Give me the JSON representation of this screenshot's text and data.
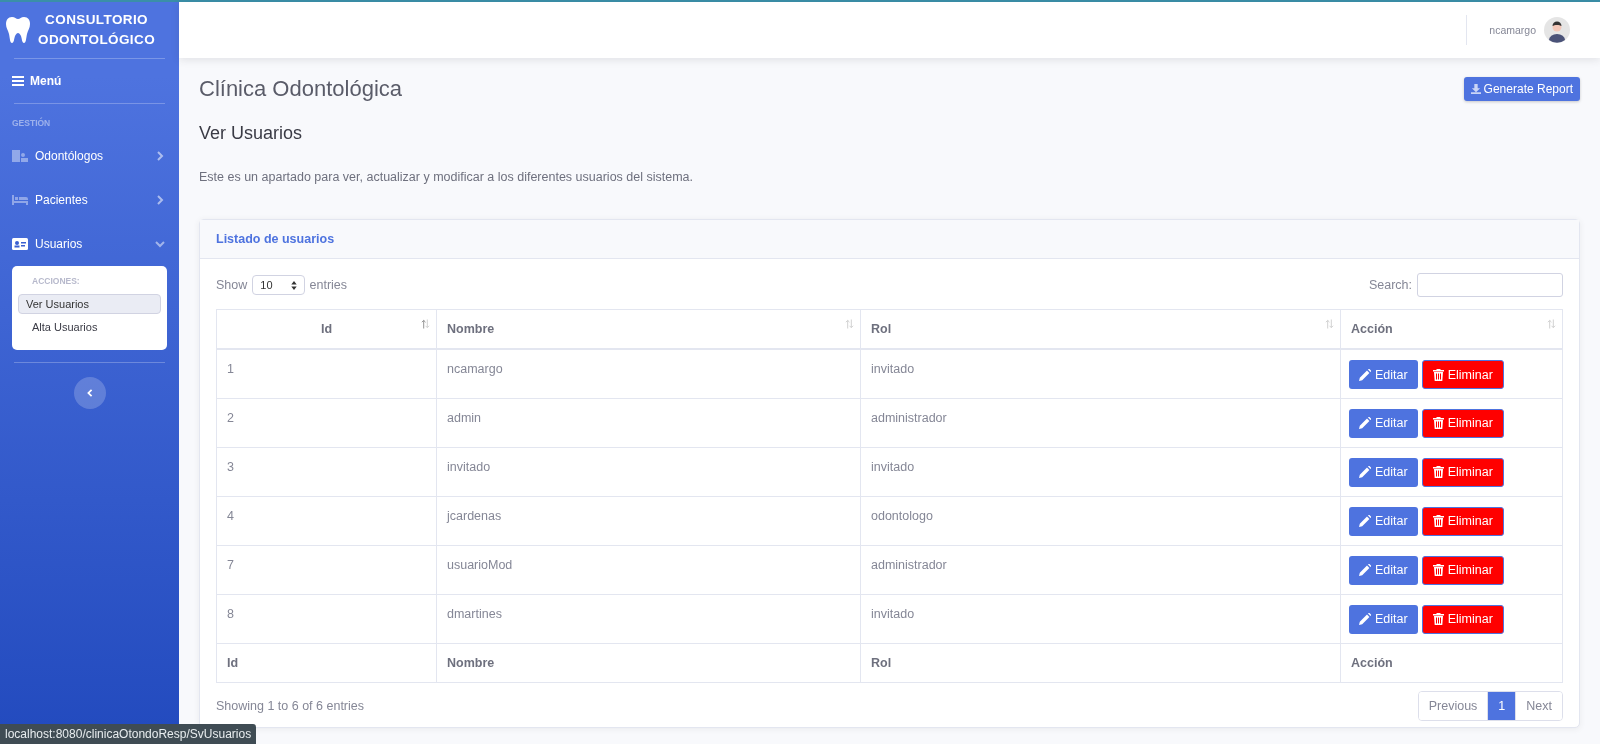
{
  "brand": {
    "line_1": "CONSULTORIO",
    "line_2": "ODONTOLÓGICO"
  },
  "sidebar": {
    "menu_label": "Menú",
    "section_heading": "GESTIÓN",
    "items": [
      {
        "label": "Odontólogos",
        "kind": "dentists",
        "expanded": false
      },
      {
        "label": "Pacientes",
        "kind": "patients",
        "expanded": false
      },
      {
        "label": "Usuarios",
        "kind": "users",
        "expanded": true,
        "submenu": {
          "heading": "ACCIONES:",
          "items": [
            {
              "label": "Ver Usuarios",
              "selected": true
            },
            {
              "label": "Alta Usuarios",
              "selected": false
            }
          ]
        }
      }
    ]
  },
  "topbar": {
    "username": "ncamargo"
  },
  "page": {
    "title": "Clínica Odontológica",
    "report_button": "Generate Report",
    "subtitle": "Ver Usuarios",
    "description": "Este es un apartado para ver, actualizar y modificar a los diferentes usuarios del sistema."
  },
  "card": {
    "title": "Listado de usuarios",
    "show_label": "Show",
    "page_size": "10",
    "entries_label": "entries",
    "search_label": "Search:",
    "columns": [
      "Id",
      "Nombre",
      "Rol",
      "Acción"
    ],
    "rows": [
      {
        "id": "1",
        "nombre": "ncamargo",
        "rol": "invitado",
        "edit": "Editar",
        "delete": "Eliminar"
      },
      {
        "id": "2",
        "nombre": "admin",
        "rol": "administrador",
        "edit": "Editar",
        "delete": "Eliminar"
      },
      {
        "id": "3",
        "nombre": "invitado",
        "rol": "invitado",
        "edit": "Editar",
        "delete": "Eliminar"
      },
      {
        "id": "4",
        "nombre": "jcardenas",
        "rol": "odontologo",
        "edit": "Editar",
        "delete": "Eliminar"
      },
      {
        "id": "7",
        "nombre": "usuarioMod",
        "rol": "administrador",
        "edit": "Editar",
        "delete": "Eliminar"
      },
      {
        "id": "8",
        "nombre": "dmartines",
        "rol": "invitado",
        "edit": "Editar",
        "delete": "Eliminar"
      }
    ],
    "footer_columns": [
      "Id",
      "Nombre",
      "Rol",
      "Acción"
    ],
    "info": "Showing 1 to 6 of 6 entries",
    "pagination": [
      {
        "label": "Previous",
        "selected": false
      },
      {
        "label": "1",
        "selected": true
      },
      {
        "label": "Next",
        "selected": false
      }
    ]
  },
  "status_url": "localhost:8080/clinicaOtondoResp/SvUsuarios"
}
